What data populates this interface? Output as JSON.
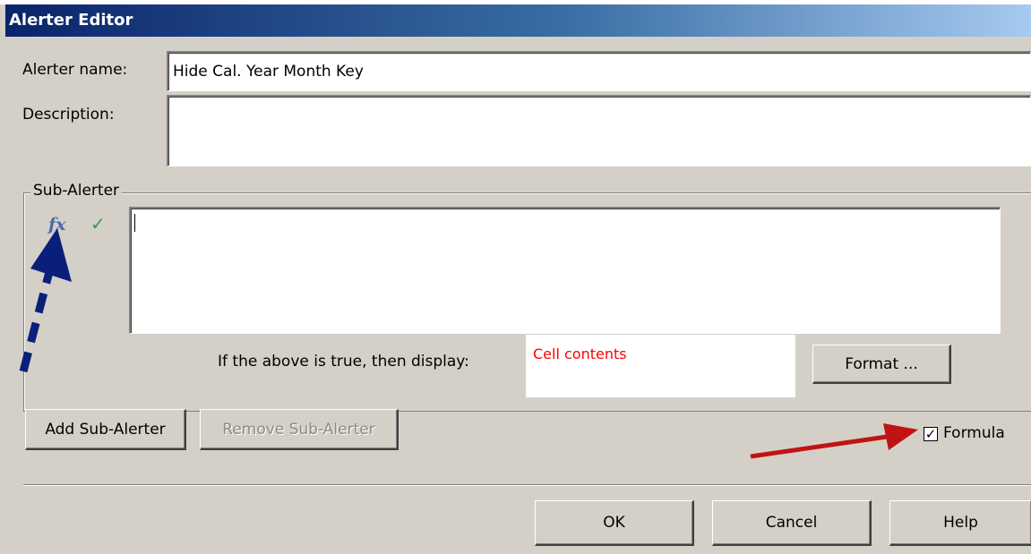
{
  "window": {
    "title": "Alerter Editor"
  },
  "form": {
    "name_label": "Alerter name:",
    "name_value": "Hide Cal. Year Month Key",
    "description_label": "Description:",
    "description_value": ""
  },
  "sub_alerter": {
    "legend": "Sub-Alerter",
    "formula_icon": "fx",
    "check_icon": "✓",
    "formula_value": "",
    "display_label": "If the above is true, then display:",
    "display_value": "Cell contents",
    "display_color": "#ff0000",
    "format_button": "Format ..."
  },
  "actions": {
    "add_button": "Add Sub-Alerter",
    "remove_button": "Remove Sub-Alerter",
    "formula_checkbox_label": "Formula",
    "formula_checked": true,
    "ok_button": "OK",
    "cancel_button": "Cancel",
    "help_button": "Help"
  },
  "annotations": {
    "blue_arrow_color": "#0a1f7a",
    "red_arrow_color": "#c01414"
  }
}
